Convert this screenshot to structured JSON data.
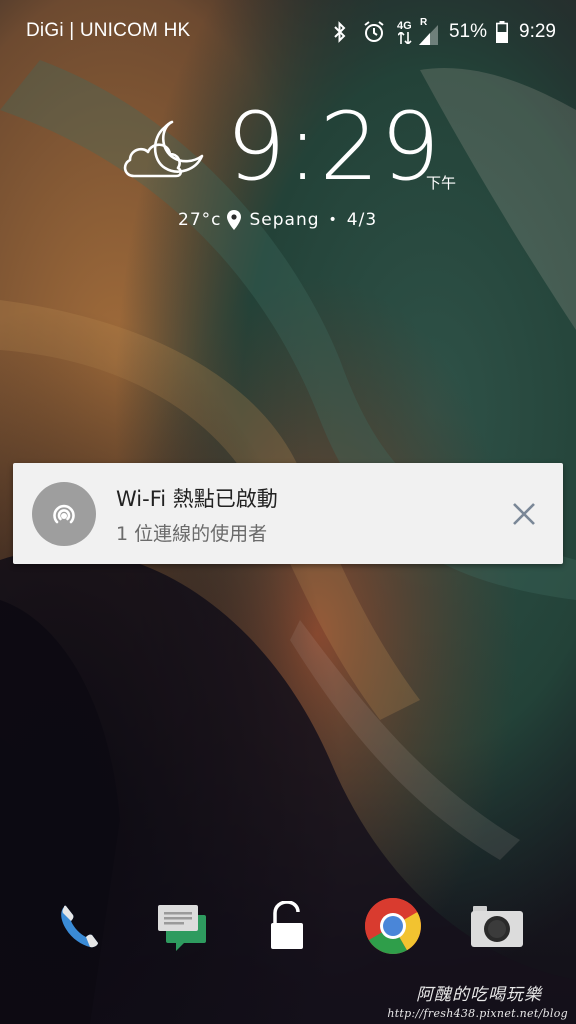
{
  "status_bar": {
    "carrier": "DiGi | UNICOM HK",
    "network_label": "4G",
    "roaming_label": "R",
    "battery": "51%",
    "time": "9:29",
    "icons": [
      "bluetooth-icon",
      "alarm-icon",
      "signal-icon",
      "battery-icon"
    ]
  },
  "lockscreen": {
    "time": "9:29",
    "ampm": "下午",
    "temperature": "27°c",
    "location": "Sepang",
    "separator": "•",
    "date": "4/3",
    "weather_icon": "cloudy-night-icon"
  },
  "notification": {
    "icon": "wifi-hotspot-icon",
    "title": "Wi-Fi 熱點已啟動",
    "subtitle": "1 位連線的使用者",
    "close_icon": "close-icon"
  },
  "dock": {
    "items": [
      "phone-icon",
      "messages-icon",
      "unlock-icon",
      "chrome-icon",
      "camera-icon"
    ]
  },
  "watermark": {
    "title": "阿醜的吃喝玩樂",
    "url": "http://fresh438.pixnet.net/blog"
  },
  "colors": {
    "notification_bg": "#f1f1f1",
    "notification_icon_bg": "#9e9e9e",
    "close_icon": "#7a8797"
  }
}
